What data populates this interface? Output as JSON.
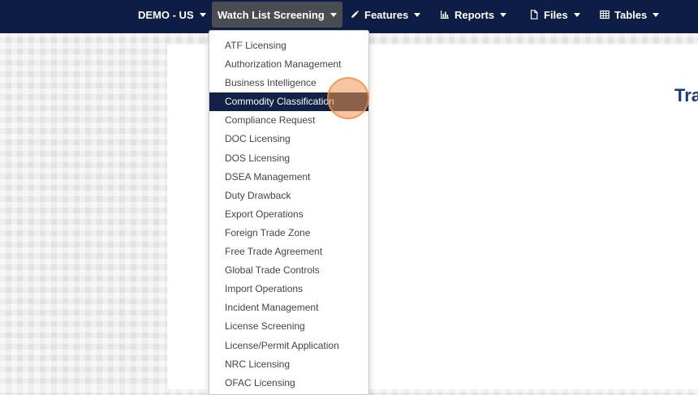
{
  "nav": {
    "items": [
      {
        "label": "DEMO - US",
        "icon": ""
      },
      {
        "label": "Watch List Screening",
        "icon": ""
      },
      {
        "label": "Features",
        "icon": "pencil-icon"
      },
      {
        "label": "Reports",
        "icon": "bar-chart-icon"
      },
      {
        "label": "Files",
        "icon": "file-icon"
      },
      {
        "label": "Tables",
        "icon": "table-icon"
      }
    ]
  },
  "content": {
    "title_visible": "Tra"
  },
  "dropdown": {
    "highlighted": "Commodity Classification",
    "items": [
      "ATF Licensing",
      "Authorization Management",
      "Business Intelligence",
      "Commodity Classification",
      "Compliance Request",
      "DOC Licensing",
      "DOS Licensing",
      "DSEA Management",
      "Duty Drawback",
      "Export Operations",
      "Foreign Trade Zone",
      "Free Trade Agreement",
      "Global Trade Controls",
      "Import Operations",
      "Incident Management",
      "License Screening",
      "License/Permit Application",
      "NRC Licensing",
      "OFAC Licensing"
    ]
  },
  "colors": {
    "topbar": "#0e1d45",
    "active_nav": "#494d52",
    "highlight": "#122247",
    "title": "#1b3a7a",
    "cursor": "#f0965099"
  }
}
